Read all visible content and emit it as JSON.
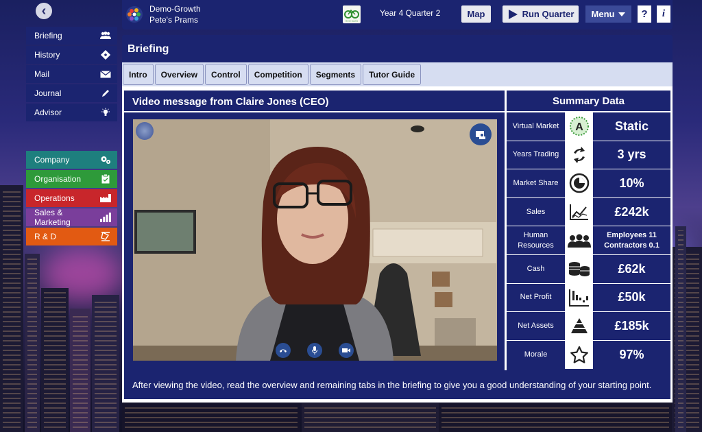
{
  "topbar": {
    "brand_name": "Demo-Growth",
    "company_name": "Pete's Prams",
    "company_logo_text": "Green Cycles",
    "period": "Year 4 Quarter 2",
    "map_label": "Map",
    "run_label": "Run Quarter",
    "menu_label": "Menu",
    "help_label": "?",
    "info_label": "i"
  },
  "sidebar": {
    "primary": [
      {
        "label": "Briefing",
        "icon": "people-icon"
      },
      {
        "label": "History",
        "icon": "history-icon"
      },
      {
        "label": "Mail",
        "icon": "envelope-icon"
      },
      {
        "label": "Journal",
        "icon": "pencil-icon"
      },
      {
        "label": "Advisor",
        "icon": "lightbulb-icon"
      }
    ],
    "departments": [
      {
        "label": "Company",
        "icon": "gears-icon",
        "color": "#1e7f7e"
      },
      {
        "label": "Organisation",
        "icon": "clipboard-icon",
        "color": "#2e9a3a"
      },
      {
        "label": "Operations",
        "icon": "factory-icon",
        "color": "#c8262b"
      },
      {
        "label": "Sales & Marketing",
        "icon": "bar-chart-icon",
        "color": "#7a3e9b"
      },
      {
        "label": "R & D",
        "icon": "flask-icon",
        "color": "#e25a12"
      }
    ]
  },
  "main": {
    "title": "Briefing",
    "tabs": [
      "Intro",
      "Overview",
      "Control",
      "Competition",
      "Segments",
      "Tutor Guide"
    ],
    "video_title": "Video message from Claire Jones (CEO)",
    "summary_title": "Summary Data",
    "footer_note": "After viewing the video, read the overview and remaining tabs in the briefing to give you a good understanding of your starting point."
  },
  "summary": [
    {
      "label": "Virtual Market",
      "icon": "market-a-icon",
      "value": "Static"
    },
    {
      "label": "Years Trading",
      "icon": "cycle-arrows-icon",
      "value": "3 yrs"
    },
    {
      "label": "Market Share",
      "icon": "pie-icon",
      "value": "10%"
    },
    {
      "label": "Sales",
      "icon": "sales-chart-icon",
      "value": "£242k"
    },
    {
      "label": "Human Resources",
      "icon": "team-icon",
      "value": "Employees 11\nContractors 0.1",
      "line1": "Employees 11",
      "line2": "Contractors 0.1"
    },
    {
      "label": "Cash",
      "icon": "coins-icon",
      "value": "£62k"
    },
    {
      "label": "Net Profit",
      "icon": "profit-bars-icon",
      "value": "£50k"
    },
    {
      "label": "Net Assets",
      "icon": "pyramid-icon",
      "value": "£185k"
    },
    {
      "label": "Morale",
      "icon": "star-icon",
      "value": "97%"
    }
  ]
}
